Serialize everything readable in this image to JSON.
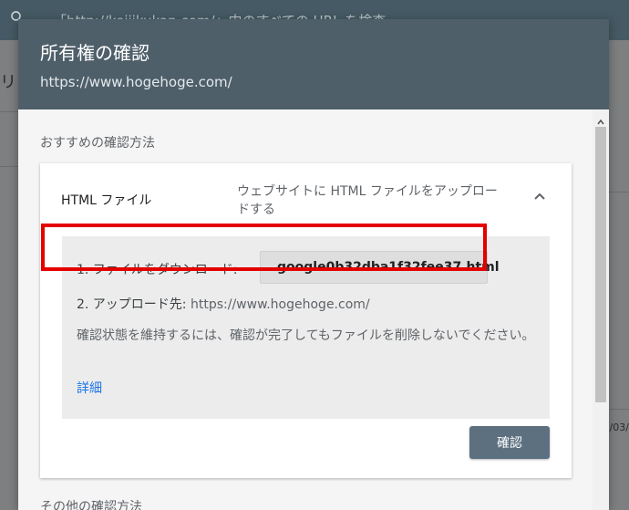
{
  "background": {
    "search_placeholder": "「http://keijikukan.com/」内のすべての URL を検査",
    "left_fragment": "リ",
    "right_date_fragment": "/03/"
  },
  "dialog": {
    "title": "所有権の確認",
    "subtitle": "https://www.hogehoge.com/",
    "recommended_label": "おすすめの確認方法",
    "card": {
      "title": "HTML ファイル",
      "description": "ウェブサイトに HTML ファイルをアップロードする",
      "step1_label": "1. ファイルをダウンロード:",
      "download_filename": "google0b32dba1f32fee37.html",
      "step2_label": "2. アップロード先:",
      "step2_url": "https://www.hogehoge.com/",
      "note": "確認状態を維持するには、確認が完了してもファイルを削除しないでください。",
      "details_link": "詳細",
      "verify_button": "確認"
    },
    "other_methods_label": "その他の確認方法"
  },
  "colors": {
    "header_bg": "#4e5f6a",
    "verify_button_bg": "#5c7080",
    "highlight_border": "#e50000",
    "link": "#1a73e8"
  }
}
